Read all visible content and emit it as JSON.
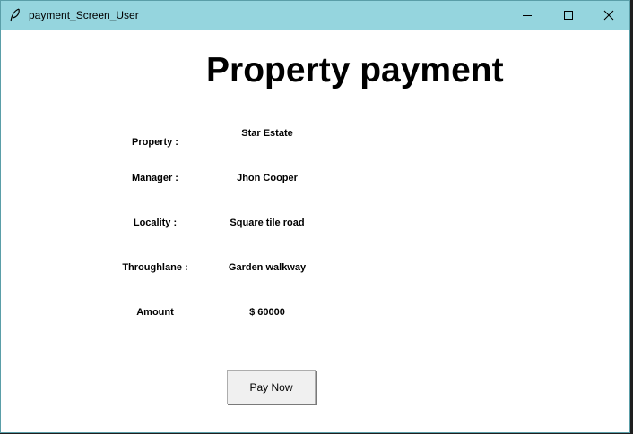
{
  "window": {
    "title": "payment_Screen_User",
    "icon": "feather-icon",
    "titlebar_color": "#95d5de"
  },
  "main": {
    "heading": "Property payment",
    "fields": [
      {
        "label": "Property :",
        "value": "Star Estate"
      },
      {
        "label": "Manager :",
        "value": "Jhon Cooper"
      },
      {
        "label": "Locality :",
        "value": "Square tile road"
      },
      {
        "label": "Throughlane :",
        "value": "Garden walkway"
      },
      {
        "label": "Amount",
        "value": "$ 60000"
      }
    ],
    "pay_button_label": "Pay Now"
  }
}
